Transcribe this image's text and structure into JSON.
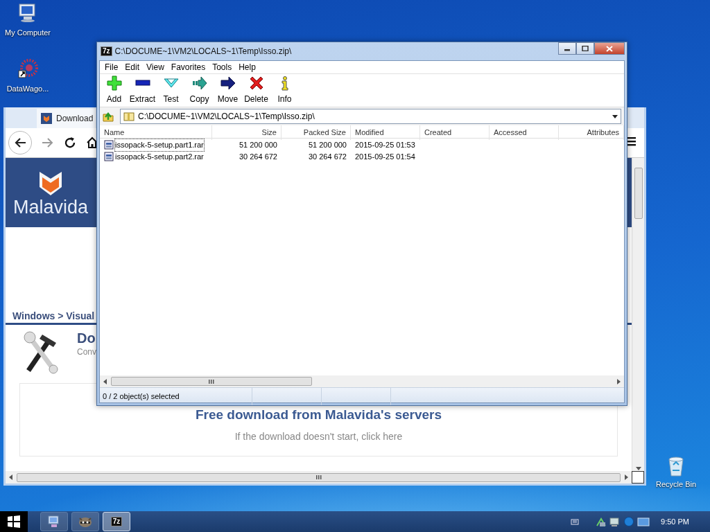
{
  "desktop_icons": [
    {
      "kind": "computer",
      "label": "My Computer"
    },
    {
      "kind": "shortcut",
      "label": "DataWago..."
    },
    {
      "kind": "recycle",
      "label": "Recycle Bin"
    }
  ],
  "browser": {
    "tab_title": "Download",
    "logo_text": "Malavida",
    "breadcrumb": "Windows > Visual",
    "heading": "Do",
    "subheading": "Conv",
    "download_title": "Free download from Malavida's servers",
    "download_note": "If the download doesn't start, click",
    "download_link": "here"
  },
  "archive_window": {
    "app_icon": "7z",
    "title": "C:\\DOCUME~1\\VM2\\LOCALS~1\\Temp\\Isso.zip\\",
    "menu": [
      "File",
      "Edit",
      "View",
      "Favorites",
      "Tools",
      "Help"
    ],
    "toolbar": [
      {
        "kind": "add",
        "label": "Add"
      },
      {
        "kind": "extract",
        "label": "Extract"
      },
      {
        "kind": "test",
        "label": "Test"
      },
      {
        "kind": "copy",
        "label": "Copy"
      },
      {
        "kind": "move",
        "label": "Move"
      },
      {
        "kind": "delete",
        "label": "Delete"
      },
      {
        "kind": "info",
        "label": "Info"
      }
    ],
    "address": "C:\\DOCUME~1\\VM2\\LOCALS~1\\Temp\\Isso.zip\\",
    "columns": [
      {
        "label": "Name"
      },
      {
        "label": "Size"
      },
      {
        "label": "Packed Size"
      },
      {
        "label": "Modified"
      },
      {
        "label": "Created"
      },
      {
        "label": "Accessed"
      },
      {
        "label": "Attributes"
      }
    ],
    "rows": [
      {
        "cells": [
          "issopack-5-setup.part1.rar",
          "51 200 000",
          "51 200 000",
          "2015-09-25 01:53"
        ],
        "selected": false,
        "focused": true
      },
      {
        "cells": [
          "issopack-5-setup.part2.rar",
          "30 264 672",
          "30 264 672",
          "2015-09-25 01:54"
        ],
        "selected": false,
        "focused": false
      }
    ],
    "status_bar": "0 / 2 object(s) selected"
  },
  "taskbar": {
    "buttons": [
      {
        "kind": "computer",
        "selected": false
      },
      {
        "kind": "raccoon",
        "selected": false
      },
      {
        "kind": "archiver",
        "label": "7z",
        "selected": true
      }
    ],
    "clock": "9:50 PM"
  }
}
